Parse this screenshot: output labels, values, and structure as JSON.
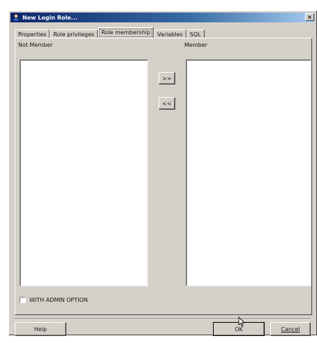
{
  "window": {
    "title": "New Login Role...",
    "close_glyph": "×"
  },
  "tabs": [
    {
      "label": "Properties"
    },
    {
      "label": "Role privileges"
    },
    {
      "label": "Role membership",
      "active": true
    },
    {
      "label": "Variables"
    },
    {
      "label": "SQL"
    }
  ],
  "membership": {
    "not_member_label": "Not Member",
    "member_label": "Member",
    "add_button": ">>",
    "remove_button": "<<",
    "not_member_items": [],
    "member_items": []
  },
  "options": {
    "with_admin_label": "WITH ADMIN OPTION",
    "with_admin_checked": false
  },
  "footer": {
    "help_button": "Help",
    "ok_button": "OK",
    "cancel_button": "Cancel"
  },
  "icons": {
    "title_icon": "user-icon",
    "cursor": "mouse-pointer-icon"
  }
}
